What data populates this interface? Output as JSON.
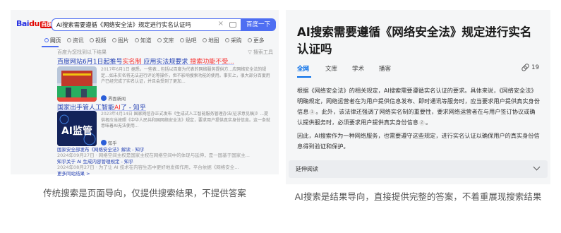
{
  "left": {
    "logo": {
      "part1": "Bai",
      "part2": "du",
      "zh": "百度"
    },
    "search": {
      "query": "AI搜索需要遵循《网络安全法》规定进行实名认证吗",
      "clear_icon": "close-icon",
      "camera_icon": "camera-icon",
      "button": "百度一下"
    },
    "tabs": [
      {
        "label": "网页",
        "active": true
      },
      {
        "label": "资讯"
      },
      {
        "label": "视频"
      },
      {
        "label": "图片"
      },
      {
        "label": "知道"
      },
      {
        "label": "文库"
      },
      {
        "label": "贴吧"
      },
      {
        "label": "地图"
      },
      {
        "label": "采购"
      },
      {
        "label": "更多"
      }
    ],
    "hint": "百度为您找到以下结果",
    "tools": "搜索工具",
    "results": [
      {
        "title_pre": "百度网站6月1日起推号",
        "title_hl": "实名制",
        "title_mid": " 应用实法规要求 ",
        "title_hl2": "搜索功能不受...",
        "snippet_date": "2017年6月1日",
        "snippet": "据悉，一些表...包括以百度为代表的网络服务提供方...应网络安全法的规定...如未实名将无法进行评论等操作，但不影响搜索功能的使用。事实上，很大部分百度用户已经完成了实名认证，并且会受到了更加...",
        "source": "界面新闻"
      },
      {
        "title_pre": "国家出手管人工智能",
        "title_hl": "AI",
        "title_mid": "了 - 知乎",
        "snippet_date": "2023年4月14日",
        "snippet": "国家网信办正式发布《生成式人工智能服务管理办法(征求意见稿)》...提供者应当按照《中华人民共和国网络安全法》规定，要求用户提供真实身份信息。这一条就意味着AI无法使用...",
        "source": "知乎"
      }
    ],
    "extras": [
      {
        "title": "国家安全部发布《网络安全法》解读 - 知乎",
        "meta": "2024年09月27日 · 网络空间主权是国家主权在网络空间中的体现与延伸，是一国基于国家主..."
      },
      {
        "title": "知乎关于 AI 生成内容管理规定 - 知乎",
        "meta": "2024年08月27日 · 为了让 AI 技术在内容生态中更好地发挥作用，平台依据《网络安全..."
      }
    ],
    "more": "更多同站结果 >"
  },
  "left_caption": "传统搜索是页面导向，仅提供搜索结果，不提供答案",
  "right": {
    "title": "AI搜索需要遵循《网络安全法》规定进行实名认证吗",
    "tabs": [
      {
        "label": "全网",
        "active": true
      },
      {
        "label": "文库"
      },
      {
        "label": "学术"
      },
      {
        "label": "播客"
      }
    ],
    "link_count": "19",
    "paragraphs": [
      {
        "text": "根据《网络安全法》的相关规定，AI搜索需要遵循实名认证的要求。具体来说，《网络安全法》明确规定，网络运营者在为用户提供信息发布、即时通讯等服务时，应当要求用户提供真实身份信息",
        "cite1": "1",
        "mid": "。此外，该法律还强调了网络实名制的重要性，要求网络运营者在与用户签订协议或确认提供服务时，必须要求用户提供真实身份信息",
        "cite2": "2",
        "end": "。"
      },
      {
        "text": "因此，AI搜索作为一种网络服务，也需要遵守这些规定，进行实名认证以确保用户的真实身份信息得到验证和保护。"
      }
    ],
    "expand": "延伸阅读"
  },
  "right_caption": "AI搜索是结果导向，直接提供完整的答案，不着重展现搜索结果",
  "colors": {
    "accent_blue": "#4e6ef2",
    "link_blue": "#2440b3",
    "highlight_red": "#f73131",
    "zhihu_blue": "#056de8"
  }
}
